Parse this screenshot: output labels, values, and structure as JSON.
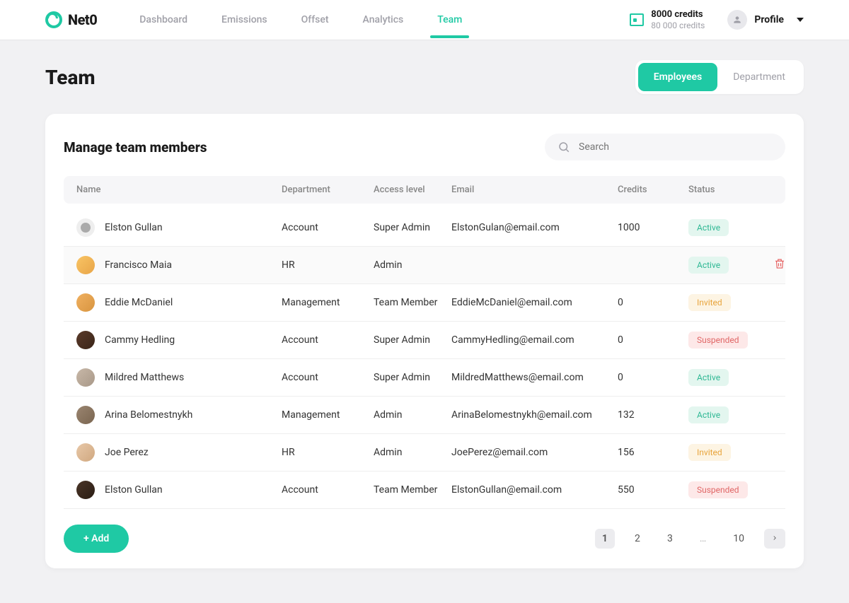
{
  "brand": "Net0",
  "nav": {
    "dashboard": "Dashboard",
    "emissions": "Emissions",
    "offset": "Offset",
    "analytics": "Analytics",
    "team": "Team"
  },
  "credits": {
    "line1": "8000 credits",
    "line2": "80 000 credits"
  },
  "profile_label": "Profile",
  "page_title": "Team",
  "tab_employees": "Employees",
  "tab_department": "Department",
  "card_title": "Manage team members",
  "search_placeholder": "Search",
  "columns": {
    "name": "Name",
    "department": "Department",
    "access": "Access level",
    "email": "Email",
    "credits": "Credits",
    "status": "Status"
  },
  "rows": [
    {
      "name": "Elston Gullan",
      "department": "Account",
      "access": "Super Admin",
      "email": "ElstonGulan@email.com",
      "credits": "1000",
      "status": "Active",
      "avatar": "ph"
    },
    {
      "name": "Francisco Maia",
      "department": "HR",
      "access": "Admin",
      "email": "",
      "credits": "",
      "status": "Active",
      "avatar": "a1",
      "hovered": true,
      "trash": true
    },
    {
      "name": "Eddie McDaniel",
      "department": "Management",
      "access": "Team Member",
      "email": "EddieMcDaniel@email.com",
      "credits": "0",
      "status": "Invited",
      "avatar": "a2"
    },
    {
      "name": "Cammy Hedling",
      "department": "Account",
      "access": "Super Admin",
      "email": "CammyHedling@email.com",
      "credits": "0",
      "status": "Suspended",
      "avatar": "a3"
    },
    {
      "name": "Mildred Matthews",
      "department": "Account",
      "access": "Super Admin",
      "email": "MildredMatthews@email.com",
      "credits": "0",
      "status": "Active",
      "avatar": "a4"
    },
    {
      "name": "Arina Belomestnykh",
      "department": "Management",
      "access": "Admin",
      "email": "ArinaBelomestnykh@email.com",
      "credits": "132",
      "status": "Active",
      "avatar": "a5"
    },
    {
      "name": "Joe Perez",
      "department": "HR",
      "access": "Admin",
      "email": "JoePerez@email.com",
      "credits": "156",
      "status": "Invited",
      "avatar": "a6"
    },
    {
      "name": "Elston Gullan",
      "department": "Account",
      "access": "Team Member",
      "email": "ElstonGullan@email.com",
      "credits": "550",
      "status": "Suspended",
      "avatar": "a7"
    }
  ],
  "add_label": "+ Add",
  "pagination": {
    "pages": [
      "1",
      "2",
      "3",
      "…",
      "10"
    ],
    "active": "1"
  }
}
